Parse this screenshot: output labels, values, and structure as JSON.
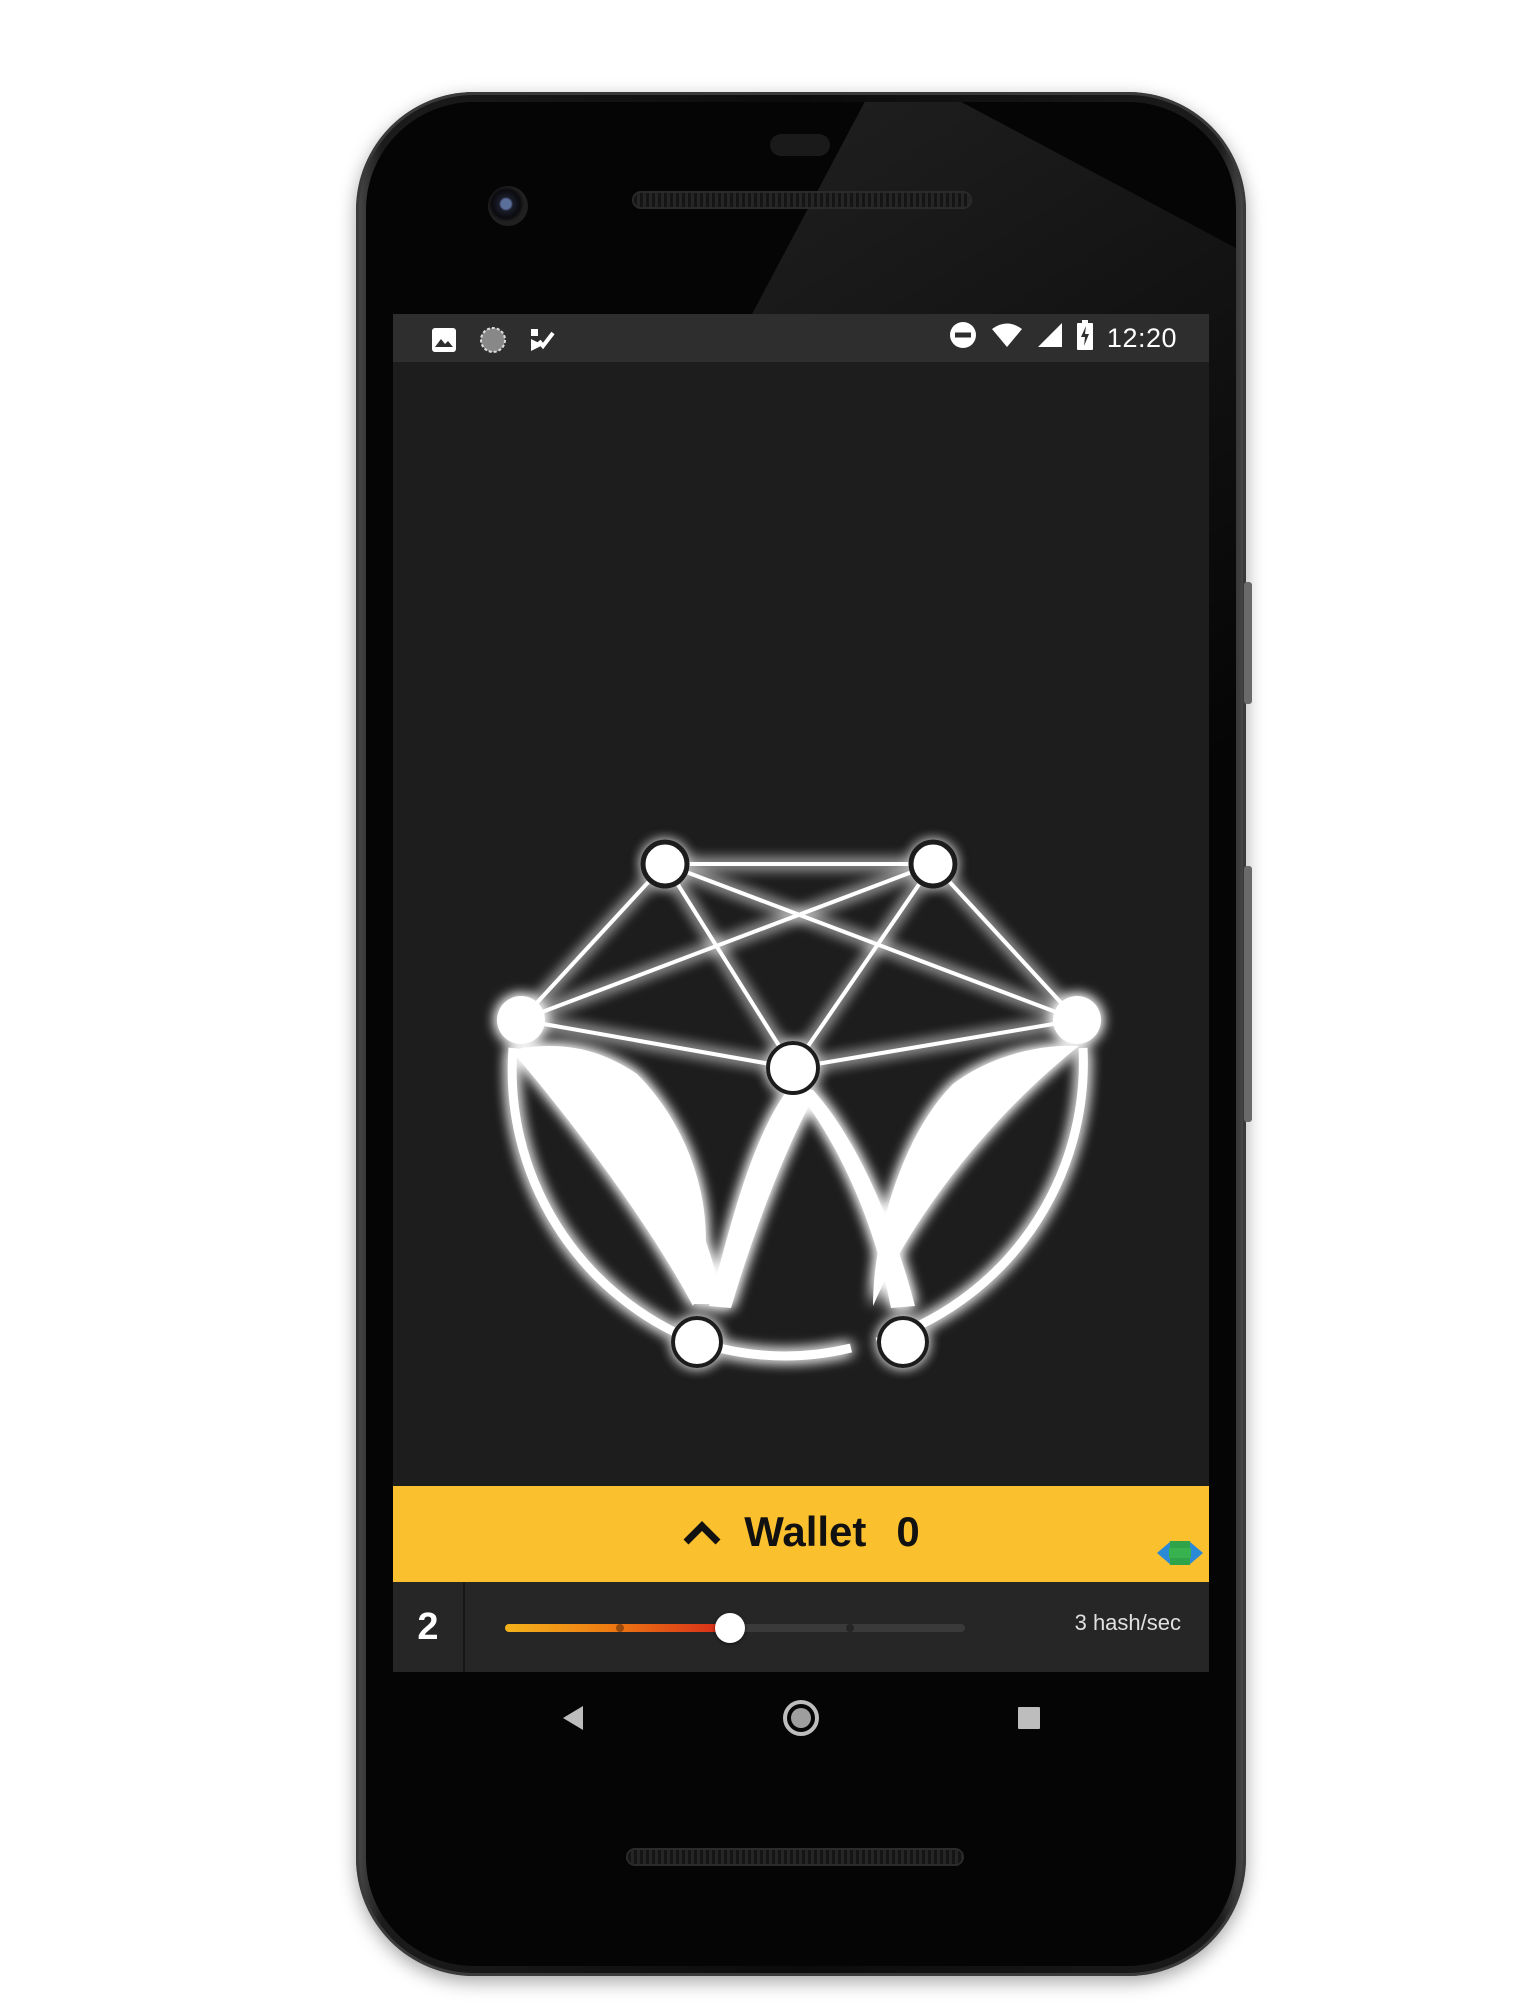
{
  "status_bar": {
    "time": "12:20",
    "left_icons": [
      "image-icon",
      "sync-circle-icon",
      "checklist-app-icon"
    ],
    "right_icons": [
      "do-not-disturb-icon",
      "wifi-icon",
      "cell-signal-icon",
      "battery-charging-icon"
    ]
  },
  "app": {
    "logo_name": "network-w-logo"
  },
  "wallet_bar": {
    "label": "Wallet",
    "value": "0",
    "expand_icon": "chevron-up-icon",
    "sync_icon": "sync-arrows-icon",
    "color": "#fbc02d"
  },
  "miner": {
    "threads": "2",
    "throttle_fraction": 0.49,
    "hashrate_text": "3 hash/sec"
  },
  "nav": {
    "icons": [
      "back-icon",
      "home-icon",
      "recents-icon"
    ]
  }
}
